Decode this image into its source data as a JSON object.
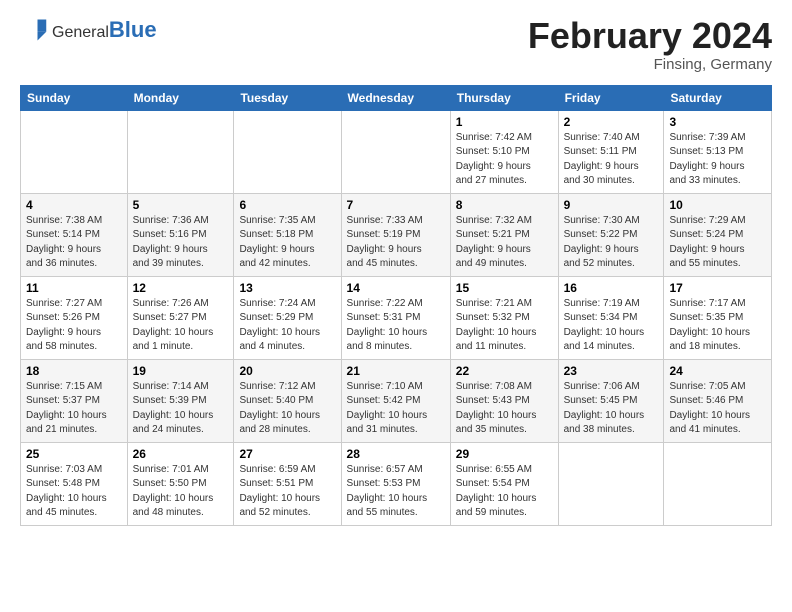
{
  "header": {
    "logo_general": "General",
    "logo_blue": "Blue",
    "month_title": "February 2024",
    "location": "Finsing, Germany"
  },
  "columns": [
    "Sunday",
    "Monday",
    "Tuesday",
    "Wednesday",
    "Thursday",
    "Friday",
    "Saturday"
  ],
  "weeks": [
    [
      {
        "day": "",
        "info": ""
      },
      {
        "day": "",
        "info": ""
      },
      {
        "day": "",
        "info": ""
      },
      {
        "day": "",
        "info": ""
      },
      {
        "day": "1",
        "info": "Sunrise: 7:42 AM\nSunset: 5:10 PM\nDaylight: 9 hours\nand 27 minutes."
      },
      {
        "day": "2",
        "info": "Sunrise: 7:40 AM\nSunset: 5:11 PM\nDaylight: 9 hours\nand 30 minutes."
      },
      {
        "day": "3",
        "info": "Sunrise: 7:39 AM\nSunset: 5:13 PM\nDaylight: 9 hours\nand 33 minutes."
      }
    ],
    [
      {
        "day": "4",
        "info": "Sunrise: 7:38 AM\nSunset: 5:14 PM\nDaylight: 9 hours\nand 36 minutes."
      },
      {
        "day": "5",
        "info": "Sunrise: 7:36 AM\nSunset: 5:16 PM\nDaylight: 9 hours\nand 39 minutes."
      },
      {
        "day": "6",
        "info": "Sunrise: 7:35 AM\nSunset: 5:18 PM\nDaylight: 9 hours\nand 42 minutes."
      },
      {
        "day": "7",
        "info": "Sunrise: 7:33 AM\nSunset: 5:19 PM\nDaylight: 9 hours\nand 45 minutes."
      },
      {
        "day": "8",
        "info": "Sunrise: 7:32 AM\nSunset: 5:21 PM\nDaylight: 9 hours\nand 49 minutes."
      },
      {
        "day": "9",
        "info": "Sunrise: 7:30 AM\nSunset: 5:22 PM\nDaylight: 9 hours\nand 52 minutes."
      },
      {
        "day": "10",
        "info": "Sunrise: 7:29 AM\nSunset: 5:24 PM\nDaylight: 9 hours\nand 55 minutes."
      }
    ],
    [
      {
        "day": "11",
        "info": "Sunrise: 7:27 AM\nSunset: 5:26 PM\nDaylight: 9 hours\nand 58 minutes."
      },
      {
        "day": "12",
        "info": "Sunrise: 7:26 AM\nSunset: 5:27 PM\nDaylight: 10 hours\nand 1 minute."
      },
      {
        "day": "13",
        "info": "Sunrise: 7:24 AM\nSunset: 5:29 PM\nDaylight: 10 hours\nand 4 minutes."
      },
      {
        "day": "14",
        "info": "Sunrise: 7:22 AM\nSunset: 5:31 PM\nDaylight: 10 hours\nand 8 minutes."
      },
      {
        "day": "15",
        "info": "Sunrise: 7:21 AM\nSunset: 5:32 PM\nDaylight: 10 hours\nand 11 minutes."
      },
      {
        "day": "16",
        "info": "Sunrise: 7:19 AM\nSunset: 5:34 PM\nDaylight: 10 hours\nand 14 minutes."
      },
      {
        "day": "17",
        "info": "Sunrise: 7:17 AM\nSunset: 5:35 PM\nDaylight: 10 hours\nand 18 minutes."
      }
    ],
    [
      {
        "day": "18",
        "info": "Sunrise: 7:15 AM\nSunset: 5:37 PM\nDaylight: 10 hours\nand 21 minutes."
      },
      {
        "day": "19",
        "info": "Sunrise: 7:14 AM\nSunset: 5:39 PM\nDaylight: 10 hours\nand 24 minutes."
      },
      {
        "day": "20",
        "info": "Sunrise: 7:12 AM\nSunset: 5:40 PM\nDaylight: 10 hours\nand 28 minutes."
      },
      {
        "day": "21",
        "info": "Sunrise: 7:10 AM\nSunset: 5:42 PM\nDaylight: 10 hours\nand 31 minutes."
      },
      {
        "day": "22",
        "info": "Sunrise: 7:08 AM\nSunset: 5:43 PM\nDaylight: 10 hours\nand 35 minutes."
      },
      {
        "day": "23",
        "info": "Sunrise: 7:06 AM\nSunset: 5:45 PM\nDaylight: 10 hours\nand 38 minutes."
      },
      {
        "day": "24",
        "info": "Sunrise: 7:05 AM\nSunset: 5:46 PM\nDaylight: 10 hours\nand 41 minutes."
      }
    ],
    [
      {
        "day": "25",
        "info": "Sunrise: 7:03 AM\nSunset: 5:48 PM\nDaylight: 10 hours\nand 45 minutes."
      },
      {
        "day": "26",
        "info": "Sunrise: 7:01 AM\nSunset: 5:50 PM\nDaylight: 10 hours\nand 48 minutes."
      },
      {
        "day": "27",
        "info": "Sunrise: 6:59 AM\nSunset: 5:51 PM\nDaylight: 10 hours\nand 52 minutes."
      },
      {
        "day": "28",
        "info": "Sunrise: 6:57 AM\nSunset: 5:53 PM\nDaylight: 10 hours\nand 55 minutes."
      },
      {
        "day": "29",
        "info": "Sunrise: 6:55 AM\nSunset: 5:54 PM\nDaylight: 10 hours\nand 59 minutes."
      },
      {
        "day": "",
        "info": ""
      },
      {
        "day": "",
        "info": ""
      }
    ]
  ]
}
